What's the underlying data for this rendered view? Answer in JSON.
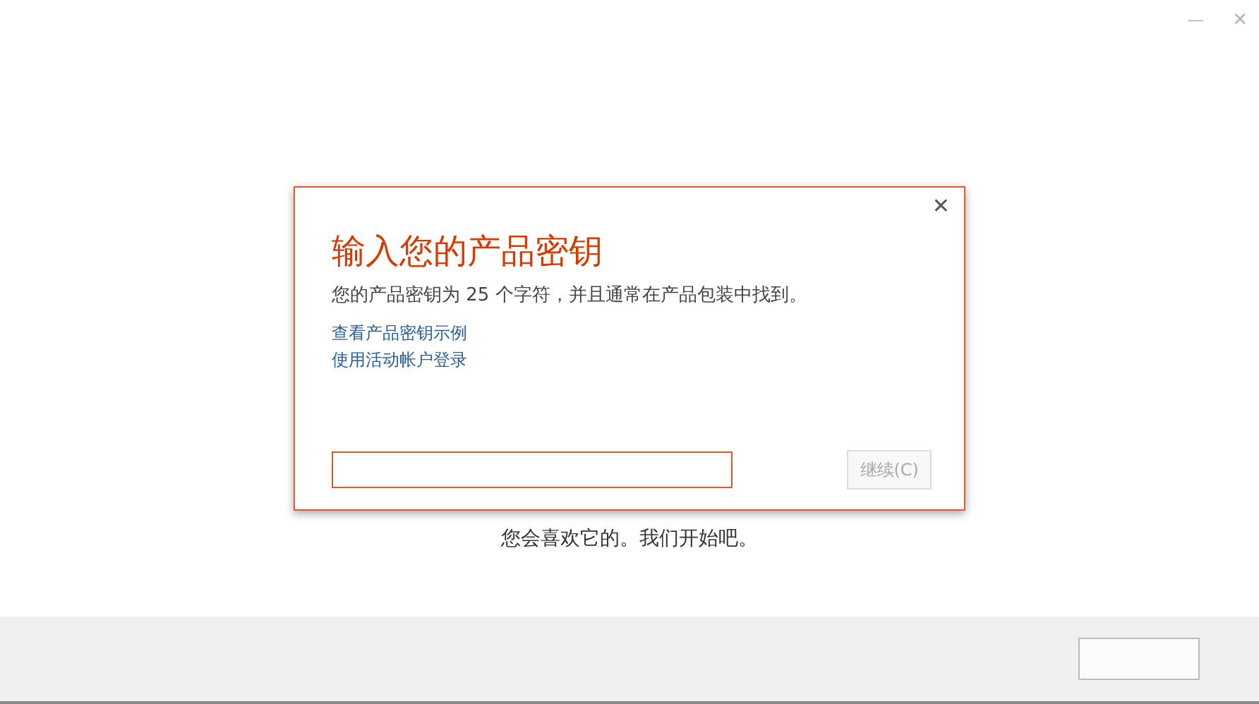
{
  "window_controls": {
    "minimize": "—",
    "close": "✕"
  },
  "page": {
    "subtitle": "您会喜欢它的。我们开始吧。"
  },
  "dialog": {
    "close": "✕",
    "title": "输入您的产品密钥",
    "description": "您的产品密钥为 25 个字符，并且通常在产品包装中找到。",
    "links": [
      "查看产品密钥示例",
      "使用活动帐户登录"
    ],
    "key_field": {
      "focused": true
    },
    "continue_button": {
      "label": "继续(C)",
      "disabled": true
    }
  }
}
